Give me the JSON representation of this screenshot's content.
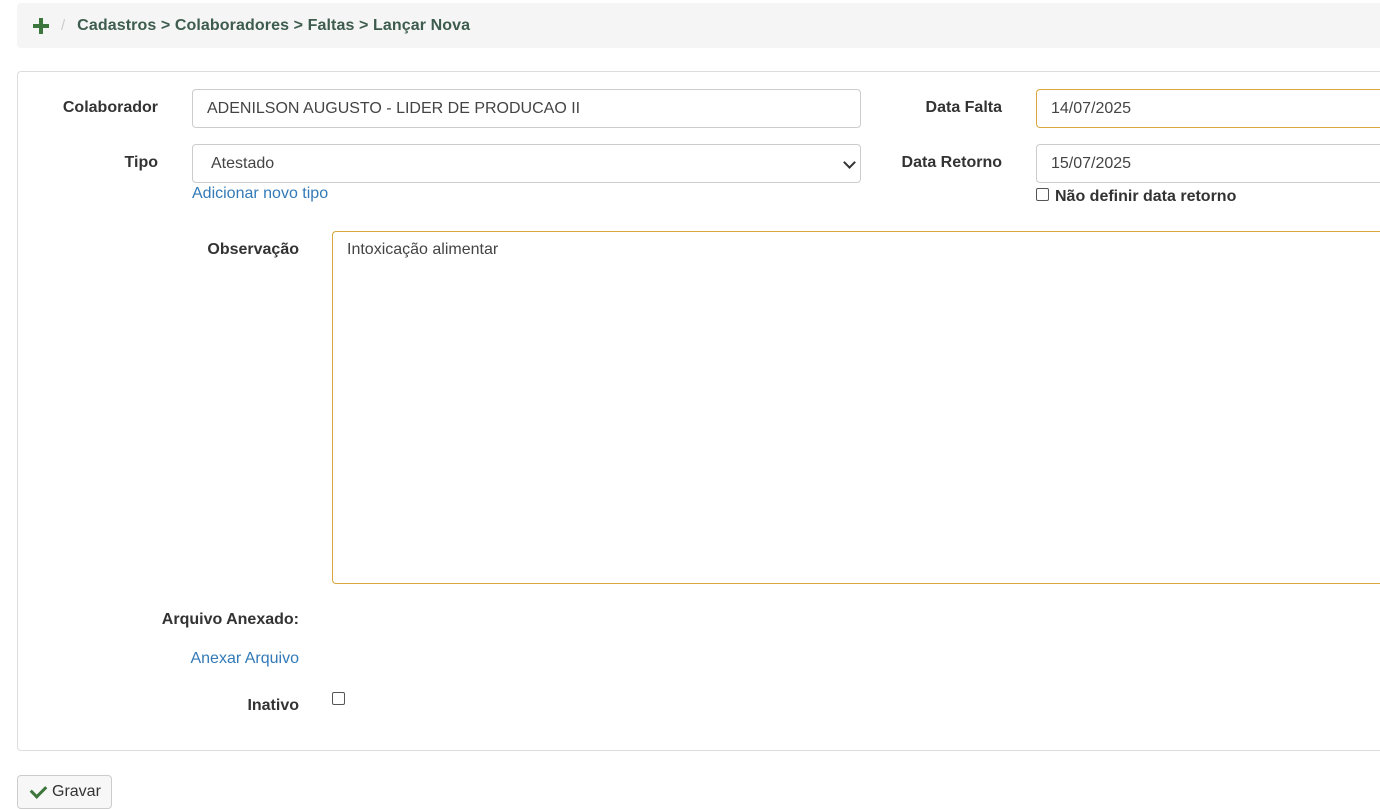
{
  "breadcrumb": {
    "separator": "/",
    "path": "Cadastros > Colaboradores > Faltas > Lançar Nova"
  },
  "form": {
    "colaborador": {
      "label": "Colaborador",
      "value": "ADENILSON AUGUSTO - LIDER DE PRODUCAO II"
    },
    "data_falta": {
      "label": "Data Falta",
      "value": "14/07/2025"
    },
    "tipo": {
      "label": "Tipo",
      "value": "Atestado",
      "add_link": "Adicionar novo tipo"
    },
    "data_retorno": {
      "label": "Data Retorno",
      "value": "15/07/2025",
      "checkbox_label": "Não definir data retorno",
      "checked": false
    },
    "observacao": {
      "label": "Observação",
      "value": "Intoxicação alimentar"
    },
    "arquivo": {
      "label": "Arquivo Anexado:",
      "link": "Anexar Arquivo"
    },
    "inativo": {
      "label": "Inativo",
      "checked": false
    }
  },
  "actions": {
    "save_label": "Gravar"
  },
  "colors": {
    "accent_green": "#3c763d",
    "link_blue": "#337ab7",
    "focus_border": "#d9a741"
  }
}
